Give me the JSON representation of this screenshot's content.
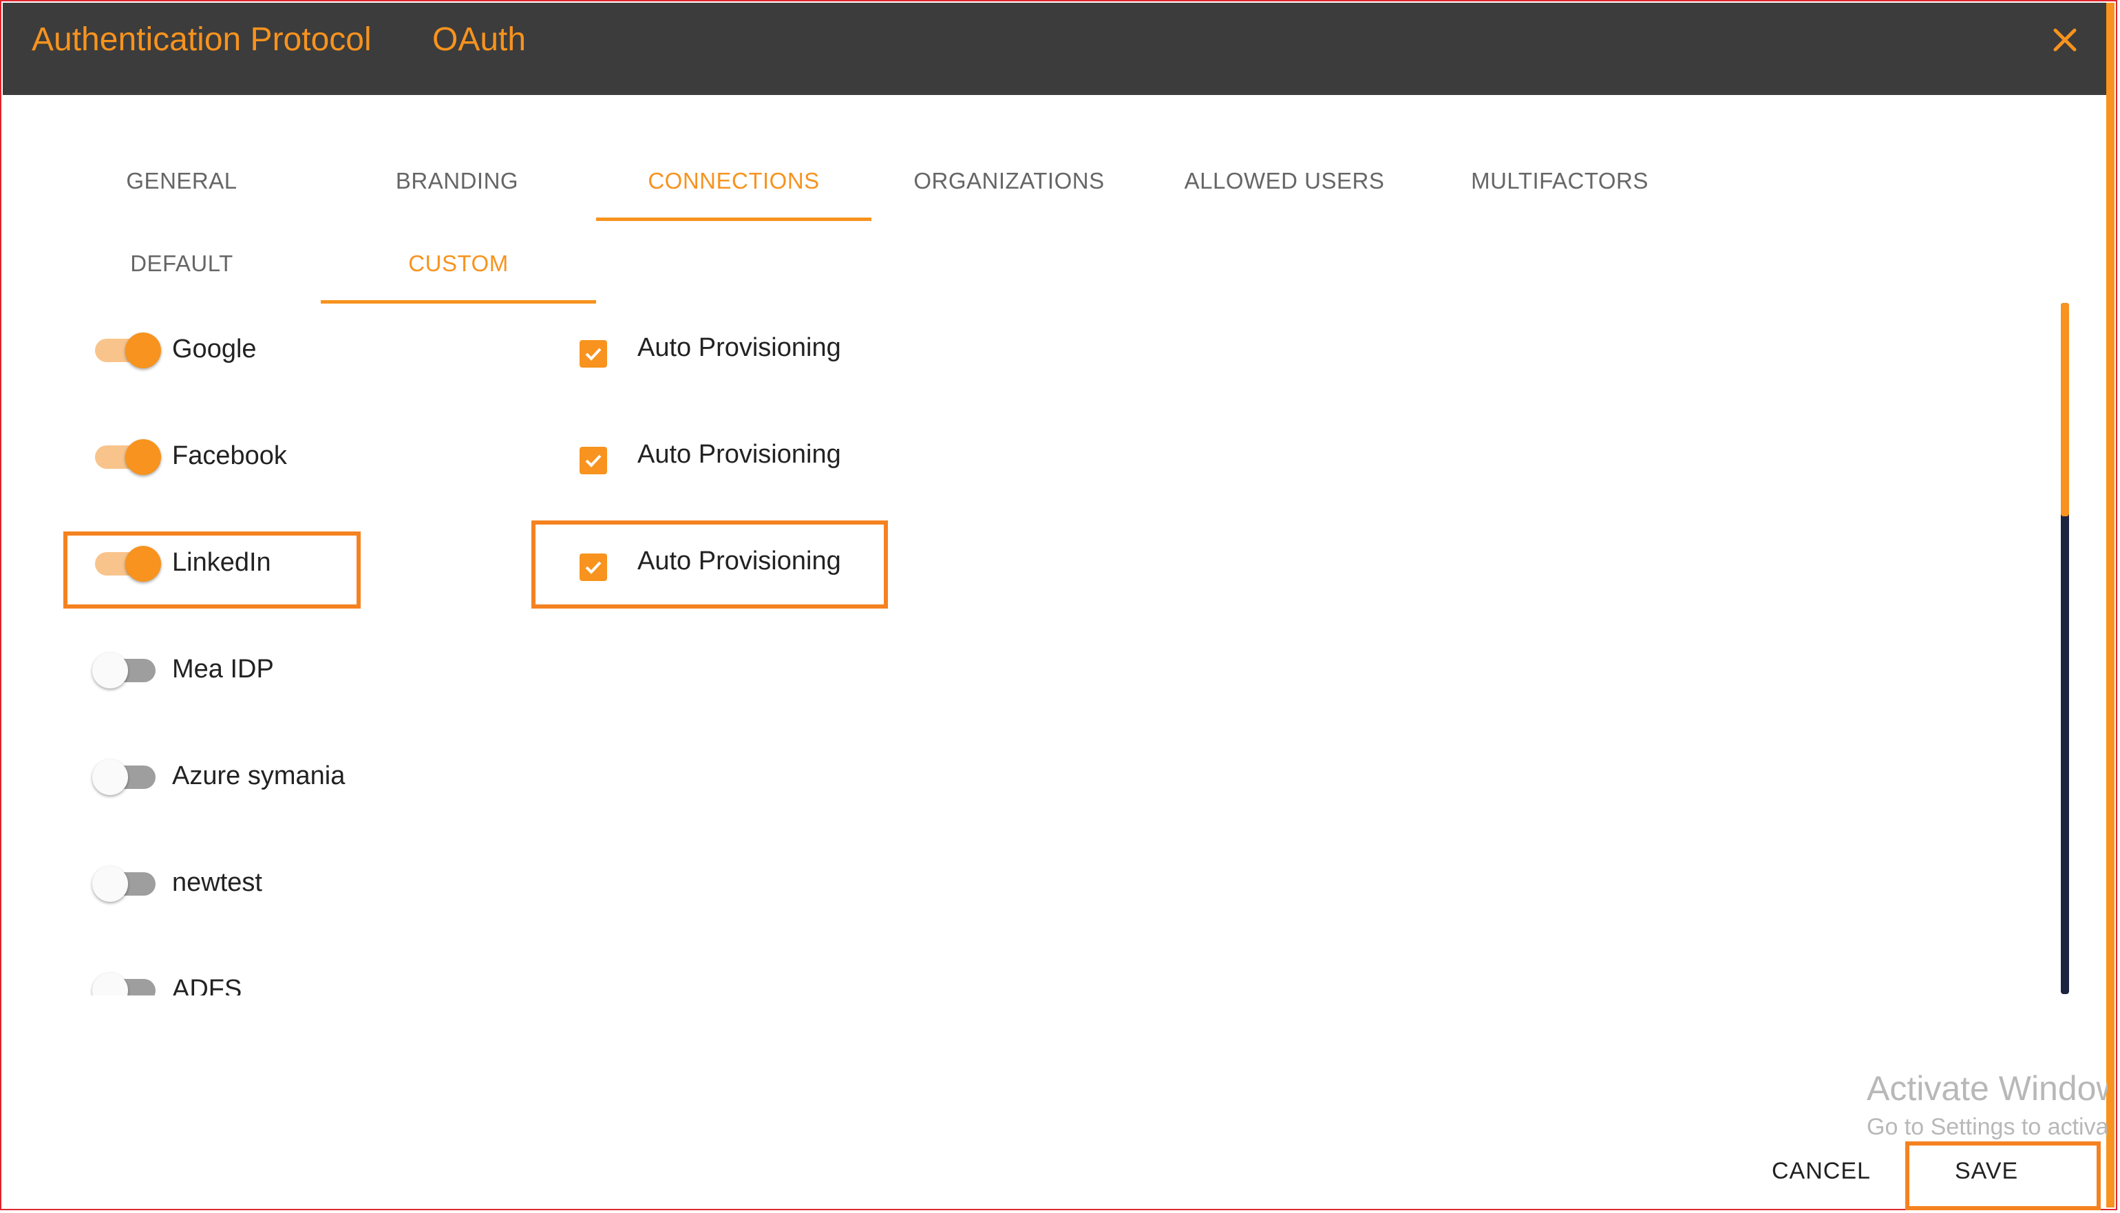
{
  "header": {
    "title": "Authentication Protocol",
    "protocol": "OAuth",
    "close_icon": "close-icon",
    "accent": "#f7931e",
    "background": "#3c3c3c"
  },
  "tabs": [
    {
      "label": "GENERAL",
      "active": false
    },
    {
      "label": "BRANDING",
      "active": false
    },
    {
      "label": "CONNECTIONS",
      "active": true
    },
    {
      "label": "ORGANIZATIONS",
      "active": false
    },
    {
      "label": "ALLOWED USERS",
      "active": false
    },
    {
      "label": "MULTIFACTORS",
      "active": false
    }
  ],
  "subtabs": [
    {
      "label": "DEFAULT",
      "active": false
    },
    {
      "label": "CUSTOM",
      "active": true
    }
  ],
  "connections": [
    {
      "name": "Google",
      "enabled": true,
      "auto_provisioning": {
        "label": "Auto Provisioning",
        "checked": true
      }
    },
    {
      "name": "Facebook",
      "enabled": true,
      "auto_provisioning": {
        "label": "Auto Provisioning",
        "checked": true
      }
    },
    {
      "name": "LinkedIn",
      "enabled": true,
      "auto_provisioning": {
        "label": "Auto Provisioning",
        "checked": true
      }
    },
    {
      "name": "Mea IDP",
      "enabled": false
    },
    {
      "name": "Azure symania",
      "enabled": false
    },
    {
      "name": "newtest",
      "enabled": false
    },
    {
      "name": "ADFS",
      "enabled": false
    }
  ],
  "watermark": {
    "line1": "Activate Windows",
    "line2": "Go to Settings to activate Windows."
  },
  "footer": {
    "cancel_label": "CANCEL",
    "save_label": "SAVE"
  }
}
